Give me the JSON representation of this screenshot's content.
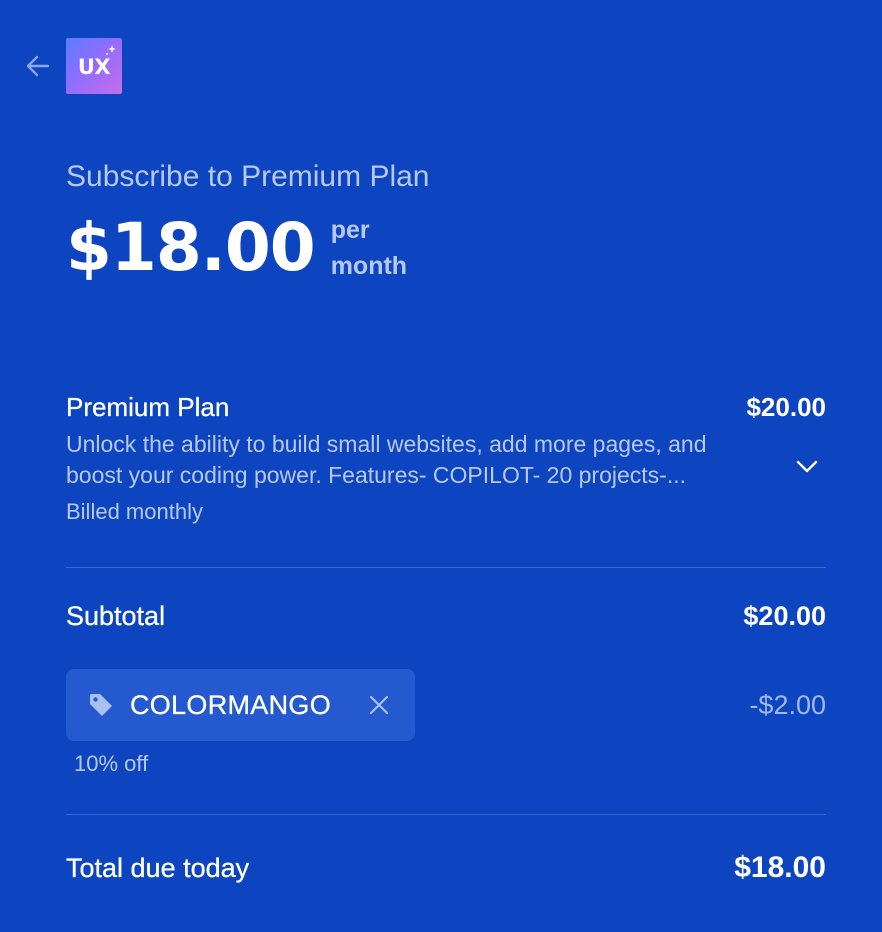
{
  "header": {
    "back_icon": "arrow-left-icon",
    "logo_text": "UX"
  },
  "checkout": {
    "title": "Subscribe to Premium Plan",
    "price": "$18.00",
    "period": "per month"
  },
  "line_item": {
    "name": "Premium Plan",
    "price": "$20.00",
    "description": "Unlock the ability to build small websites, add more pages, and boost your coding power. Features- COPILOT- 20 projects-...",
    "billing": "Billed monthly",
    "expand_icon": "chevron-down-icon"
  },
  "subtotal": {
    "label": "Subtotal",
    "value": "$20.00"
  },
  "promo": {
    "icon": "tag-icon",
    "code": "COLORMANGO",
    "remove_icon": "close-icon",
    "discount": "-$2.00",
    "note": "10% off"
  },
  "total": {
    "label": "Total due today",
    "value": "$18.00"
  },
  "colors": {
    "background": "#0d44bf",
    "muted_text": "#b7c9f3",
    "promo_chip": "#2559cf",
    "divider": "#3d68d0"
  }
}
